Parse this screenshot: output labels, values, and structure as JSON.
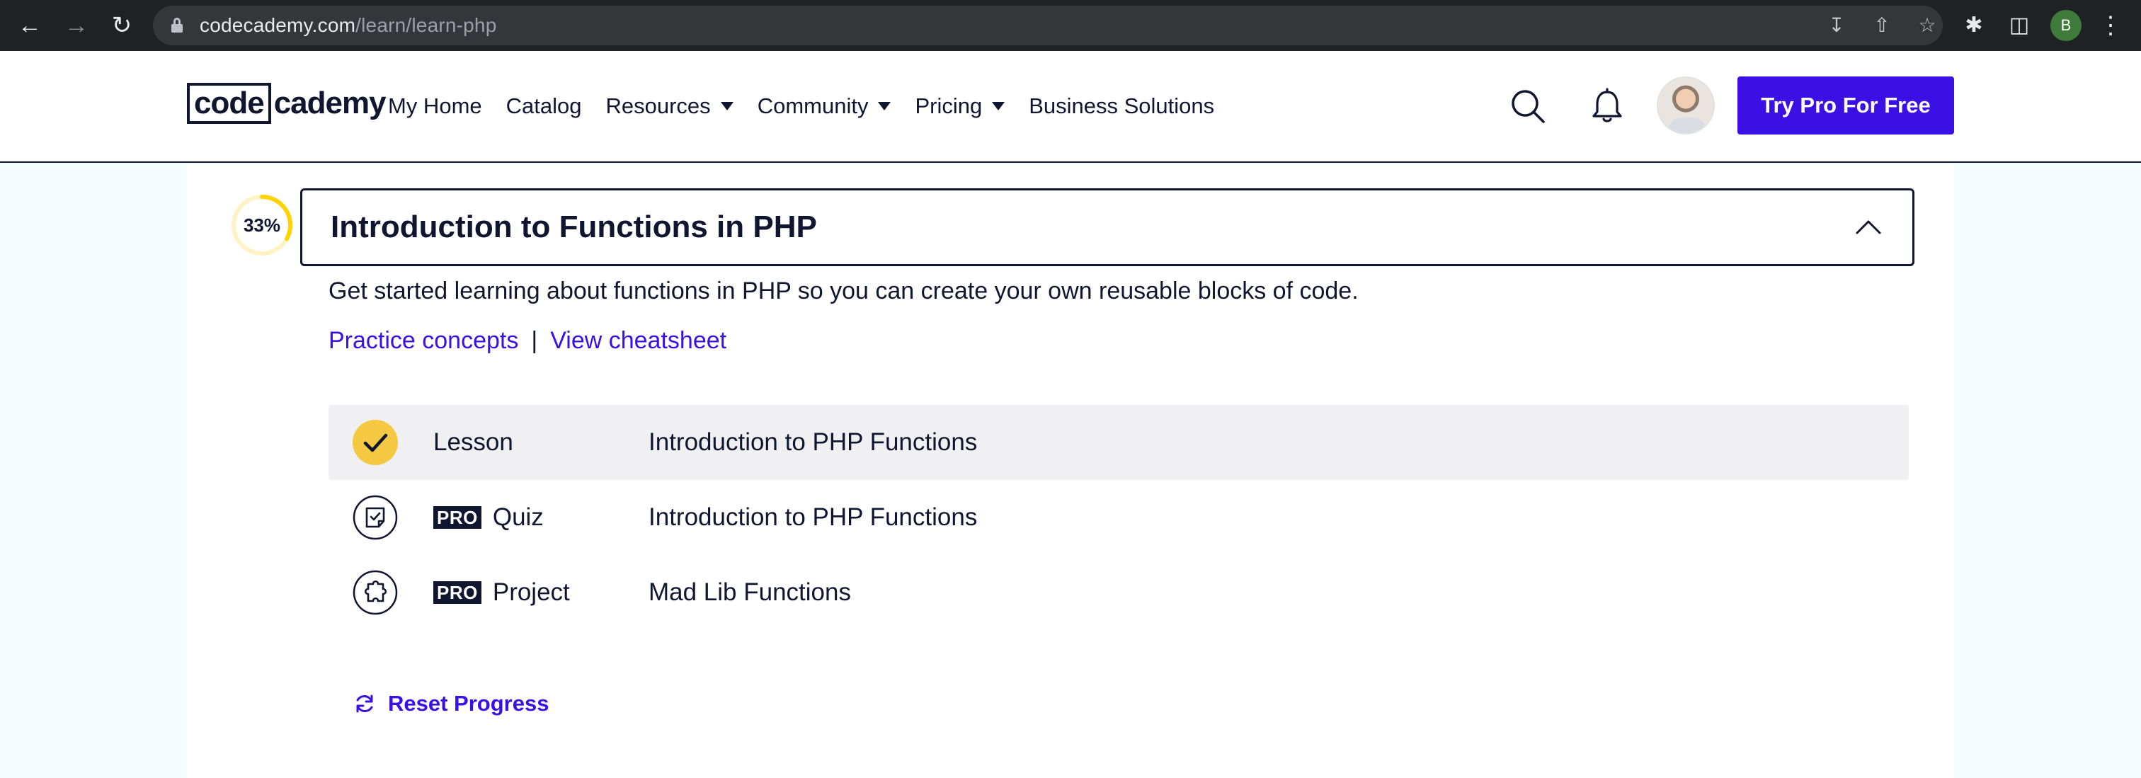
{
  "browser": {
    "url_host": "codecademy.com",
    "url_path": "/learn/learn-php",
    "profile_initial": "B"
  },
  "header": {
    "logo_box": "code",
    "logo_rest": "cademy",
    "nav": [
      {
        "label": "My Home",
        "dropdown": false
      },
      {
        "label": "Catalog",
        "dropdown": false
      },
      {
        "label": "Resources",
        "dropdown": true
      },
      {
        "label": "Community",
        "dropdown": true
      },
      {
        "label": "Pricing",
        "dropdown": true
      },
      {
        "label": "Business Solutions",
        "dropdown": false
      }
    ],
    "cta_label": "Try Pro For Free"
  },
  "module": {
    "progress_percent_label": "33%",
    "progress_fraction": 0.33,
    "title": "Introduction to Functions in PHP",
    "description": "Get started learning about functions in PHP so you can create your own reusable blocks of code.",
    "link_practice": "Practice concepts",
    "link_separator": "|",
    "link_cheatsheet": "View cheatsheet",
    "items": [
      {
        "type": "Lesson",
        "pro": false,
        "name": "Introduction to PHP Functions",
        "completed": true,
        "icon": "check-icon"
      },
      {
        "type": "Quiz",
        "pro": true,
        "pro_label": "PRO",
        "name": "Introduction to PHP Functions",
        "completed": false,
        "icon": "quiz-icon"
      },
      {
        "type": "Project",
        "pro": true,
        "pro_label": "PRO",
        "name": "Mad Lib Functions",
        "completed": false,
        "icon": "puzzle-icon"
      }
    ],
    "reset_label": "Reset Progress"
  },
  "colors": {
    "brand": "#3a10e5",
    "navy": "#10162f",
    "progress": "#ffd300",
    "page_bg": "#f5fcff",
    "check_bg": "#f5c842"
  }
}
